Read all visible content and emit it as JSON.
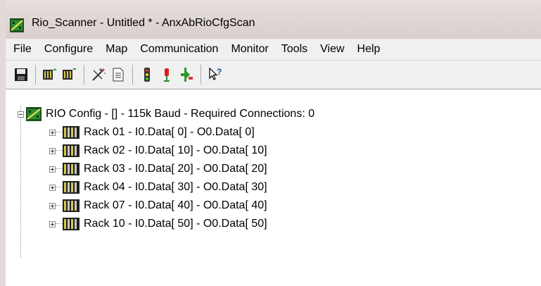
{
  "window": {
    "title": "Rio_Scanner - Untitled * - AnxAbRioCfgScan"
  },
  "menu": [
    {
      "label": "File"
    },
    {
      "label": "Configure"
    },
    {
      "label": "Map"
    },
    {
      "label": "Communication"
    },
    {
      "label": "Monitor"
    },
    {
      "label": "Tools"
    },
    {
      "label": "View"
    },
    {
      "label": "Help"
    }
  ],
  "toolbar": [
    {
      "icon": "save-icon"
    },
    {
      "icon": "rack-add-icon"
    },
    {
      "icon": "rack-remove-icon"
    },
    {
      "icon": "tools-icon"
    },
    {
      "icon": "document-icon"
    },
    {
      "icon": "traffic-light-icon"
    },
    {
      "icon": "stoplight-red-icon"
    },
    {
      "icon": "connect-icon"
    },
    {
      "icon": "help-pointer-icon"
    }
  ],
  "tree": {
    "root": {
      "label": "RIO Config - [] - 115k Baud - Required Connections: 0",
      "expanded": true
    },
    "racks": [
      {
        "label": "Rack 01 - I0.Data[ 0] - O0.Data[ 0]"
      },
      {
        "label": "Rack 02 - I0.Data[ 10] - O0.Data[ 10]"
      },
      {
        "label": "Rack 03 - I0.Data[ 20] - O0.Data[ 20]"
      },
      {
        "label": "Rack 04 - I0.Data[ 30] - O0.Data[ 30]"
      },
      {
        "label": "Rack 07 - I0.Data[ 40] - O0.Data[ 40]"
      },
      {
        "label": "Rack 10 - I0.Data[ 50] - O0.Data[ 50]"
      }
    ]
  }
}
